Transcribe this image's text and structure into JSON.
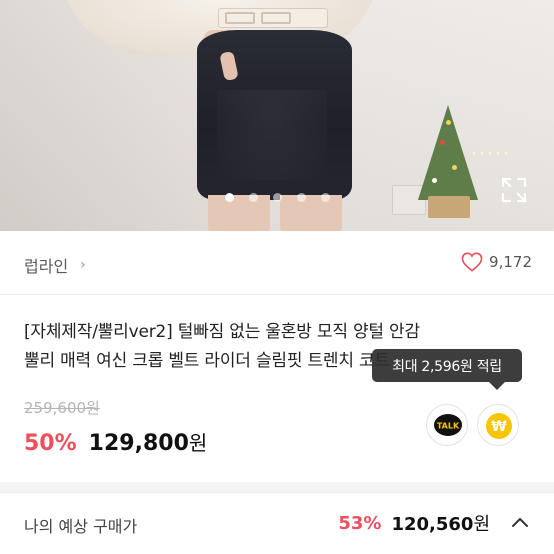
{
  "hero": {
    "carousel_pages": 5,
    "carousel_active": 1
  },
  "seller": {
    "name": "럽라인",
    "chevron": "›",
    "likes": "9,172"
  },
  "product": {
    "title_line1": "[자체제작/뿔리ver2] 털빠짐 없는 울혼방 모직 양털 안감",
    "title_line2": "뿔리 매력 여신 크롭 벨트 라이더 슬림핏 트렌치 코트"
  },
  "tooltip": {
    "text": "최대 2,596원 적립"
  },
  "pricing": {
    "original": "259,600원",
    "discount": "50%",
    "price": "129,800",
    "currency": "원"
  },
  "share": {
    "kakao_label": "TALK",
    "point_label": "₩"
  },
  "estimate": {
    "label": "나의 예상 구매가",
    "discount": "53%",
    "price": "120,560",
    "currency": "원"
  },
  "colors": {
    "accent": "#ef4e5e",
    "kakao": "#111111",
    "point": "#f7c600"
  }
}
